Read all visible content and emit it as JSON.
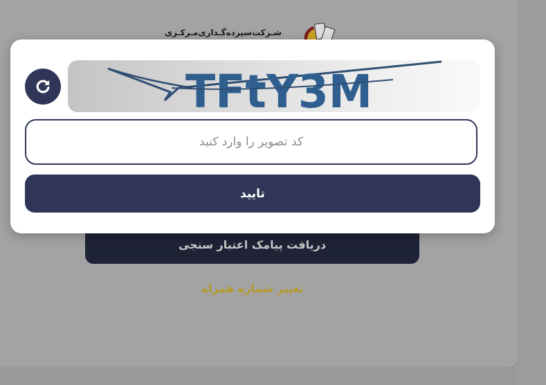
{
  "background": {
    "logo_text": "شـرکت‌سپرده‌گـذاری‌مـرکـزی",
    "sms_button_label": "دریافت پیامک اعتبار سنجی",
    "change_number_link": "تغییر شماره همراه",
    "link_color": "#b59a2a"
  },
  "captcha_modal": {
    "captcha_text": "TFtY3M",
    "refresh_icon": "refresh-icon",
    "input_placeholder": "کد تصویر را وارد کنید",
    "input_value": "",
    "confirm_label": "تایید",
    "accent_color": "#2f3657"
  }
}
